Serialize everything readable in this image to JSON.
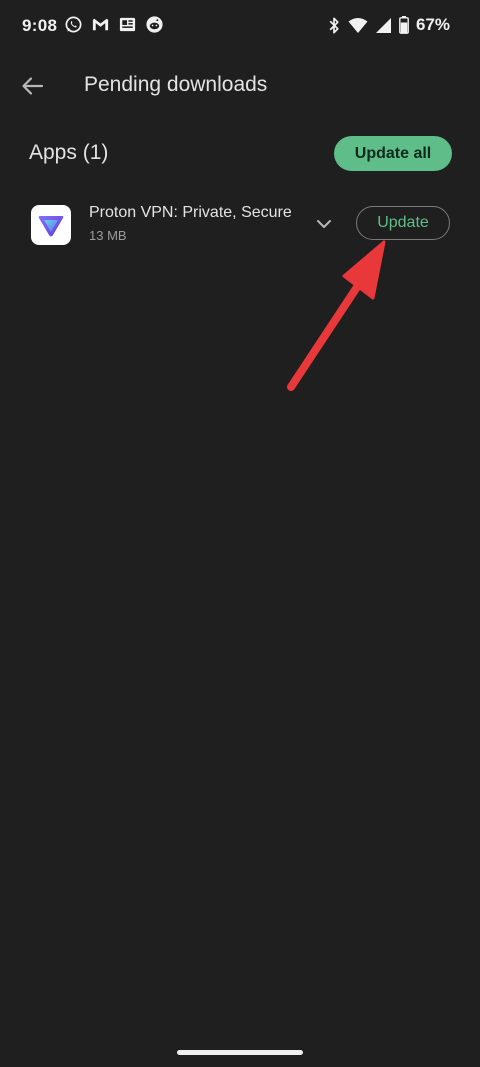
{
  "status_bar": {
    "time": "9:08",
    "notification_icons": [
      "whatsapp-icon",
      "gmail-icon",
      "news-icon",
      "reddit-icon"
    ],
    "system_icons": [
      "bluetooth-icon",
      "wifi-icon",
      "cellular-signal-icon",
      "battery-icon"
    ],
    "battery_percent": "67%"
  },
  "app_bar": {
    "back_icon": "arrow-left-icon",
    "title": "Pending downloads"
  },
  "section": {
    "title": "Apps (1)",
    "update_all_label": "Update all"
  },
  "apps": [
    {
      "name": "Proton VPN: Private, Secure",
      "size": "13 MB",
      "icon": "proton-vpn-icon",
      "expand_icon": "chevron-down-icon",
      "update_label": "Update"
    }
  ],
  "annotation": {
    "arrow_color": "#e8383a"
  },
  "colors": {
    "background": "#1f1f1f",
    "accent_green": "#5fbd8a",
    "text_primary": "#e3e3e3",
    "text_secondary": "#9a9a9a"
  }
}
